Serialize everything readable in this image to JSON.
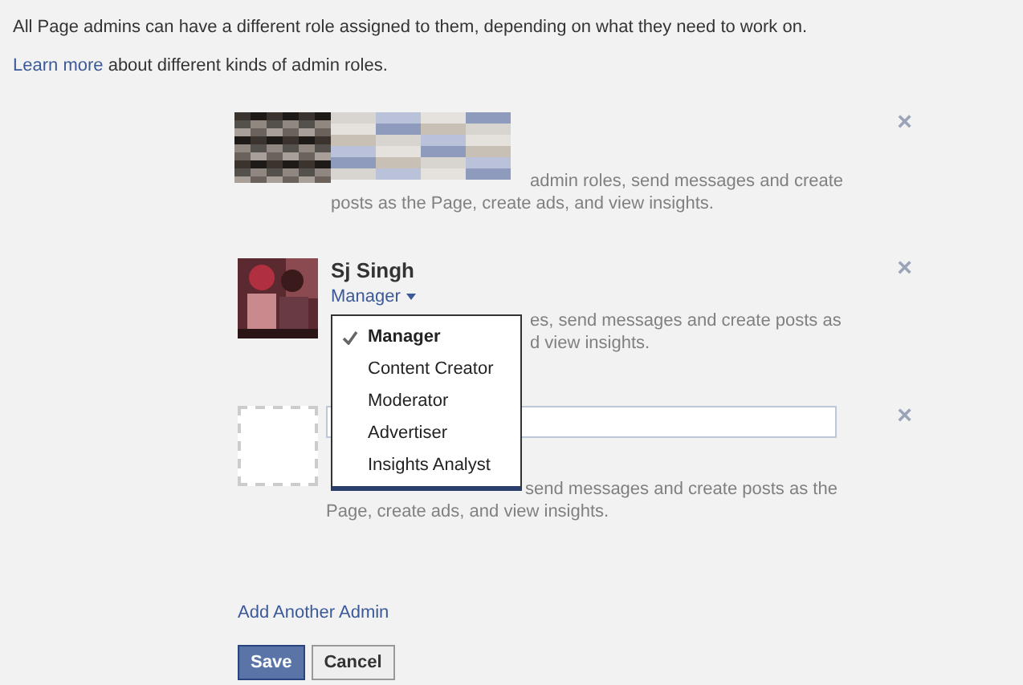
{
  "intro": "All Page admins can have a different role assigned to them, depending on what they need to work on.",
  "learn": {
    "link": "Learn more",
    "rest": " about different kinds of admin roles."
  },
  "admins": [
    {
      "kind": "hidden",
      "close": "×",
      "lines": [
        {
          "right": "admin roles, send messages and create"
        },
        {
          "left": "posts as the Page, create ads, and view insights."
        }
      ]
    },
    {
      "kind": "person",
      "name": "Sj Singh",
      "role": "Manager",
      "close": "×",
      "lines": [
        {
          "right": "es, send messages and create posts as"
        },
        {
          "right": "d view insights."
        }
      ],
      "menu": [
        {
          "label": "Manager",
          "selected": true
        },
        {
          "label": "Content Creator",
          "selected": false
        },
        {
          "label": "Moderator",
          "selected": false
        },
        {
          "label": "Advertiser",
          "selected": false
        },
        {
          "label": "Insights Analyst",
          "selected": false
        }
      ]
    },
    {
      "kind": "new",
      "close": "×",
      "lines": [
        {
          "right": "send messages and create posts as the"
        },
        {
          "left": "Page, create ads, and view insights."
        }
      ]
    }
  ],
  "add_link": "Add Another Admin",
  "buttons": [
    {
      "label": "Save",
      "kind": "primary"
    },
    {
      "label": "Cancel",
      "kind": "secondary"
    }
  ]
}
